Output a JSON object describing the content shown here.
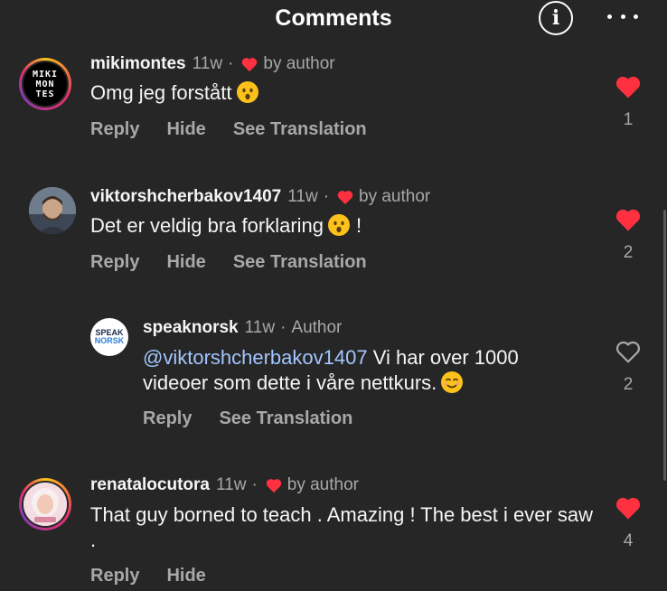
{
  "header": {
    "title": "Comments",
    "info_icon": "i",
    "icons": [
      "info-icon",
      "more-icon"
    ]
  },
  "colors": {
    "background": "#262626",
    "like_red": "#ff3040",
    "mention": "#a3c6ff",
    "muted": "#a8a8a8"
  },
  "comments": [
    {
      "username": "mikimontes",
      "time": "11w",
      "sep": "·",
      "author_tag": "by author",
      "text": "Omg jeg forstått",
      "avatar_text": [
        "MIKI",
        "MON",
        "TES"
      ],
      "actions": [
        "Reply",
        "Hide",
        "See Translation"
      ],
      "liked": true,
      "likes": "1"
    },
    {
      "username": "viktorshcherbakov1407",
      "time": "11w",
      "sep": "·",
      "author_tag": "by author",
      "text": "Det er veldig bra forklaring",
      "text_suffix": "!",
      "actions": [
        "Reply",
        "Hide",
        "See Translation"
      ],
      "liked": true,
      "likes": "2"
    },
    {
      "username": "speaknorsk",
      "time": "11w",
      "sep": "·",
      "author_label": "Author",
      "mention": "@viktorshcherbakov1407",
      "text": "Vi har over 1000 videoer som dette i våre nettkurs.",
      "avatar_text": [
        "SPEAK",
        "NORSK"
      ],
      "actions": [
        "Reply",
        "See Translation"
      ],
      "liked": false,
      "likes": "2"
    },
    {
      "username": "renatalocutora",
      "time": "11w",
      "sep": "·",
      "author_tag": "by author",
      "text": "That guy borned to teach . Amazing ! The best i ever saw .",
      "actions": [
        "Reply",
        "Hide"
      ],
      "liked": true,
      "likes": "4"
    }
  ]
}
